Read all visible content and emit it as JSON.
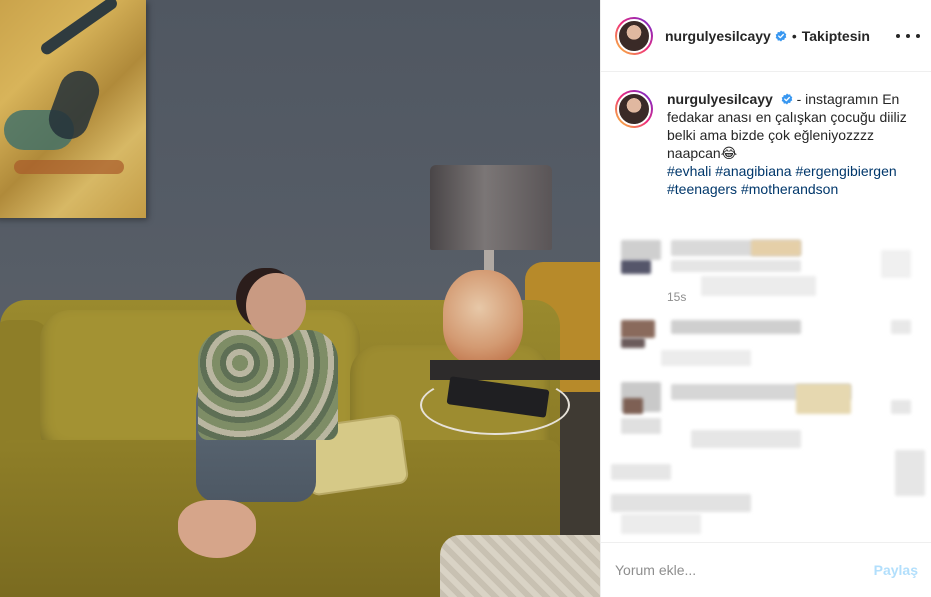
{
  "post": {
    "username": "nurgulyesilcayy",
    "follow_status": "Takiptesin",
    "separator": "•"
  },
  "caption": {
    "username": "nurgulyesilcayy",
    "text": "- instagramın En fedakar anası en çalışkan çocuğu diiliz belki ama bizde çok eğleniyozzzz naapcan😂",
    "hashtags": [
      "#evhali",
      "#anagibiana",
      "#ergengibiergen",
      "#teenagers",
      "#motherandson"
    ],
    "time": "15s"
  },
  "comment_box": {
    "placeholder": "Yorum ekle...",
    "share_label": "Paylaş"
  },
  "icons": {
    "verified": "verified-badge-icon",
    "more": "more-options-icon"
  },
  "colors": {
    "text": "#262626",
    "hashtag": "#00376b",
    "muted": "#8e8e8e",
    "share_disabled": "#b2dffc",
    "verified": "#3897f0"
  }
}
